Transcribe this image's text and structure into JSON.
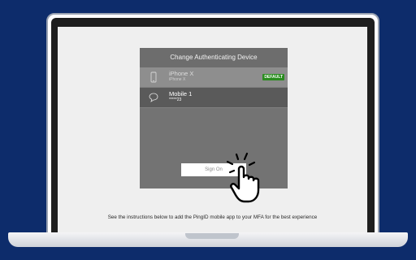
{
  "dialog": {
    "title": "Change Authenticating Device",
    "devices": [
      {
        "name": "iPhone X",
        "detail": "iPhone X",
        "badge": "DEFAULT",
        "icon": "phone-icon"
      },
      {
        "name": "Mobile 1",
        "detail": "*****23",
        "icon": "chat-bubble-icon"
      }
    ],
    "sign_on_label": "Sign On"
  },
  "instructions": "See the instructions below to add the PingID mobile app to your MFA for the best experience",
  "colors": {
    "background": "#0d2c6b",
    "badge": "#2a8c1f",
    "dialog": "#737373"
  }
}
